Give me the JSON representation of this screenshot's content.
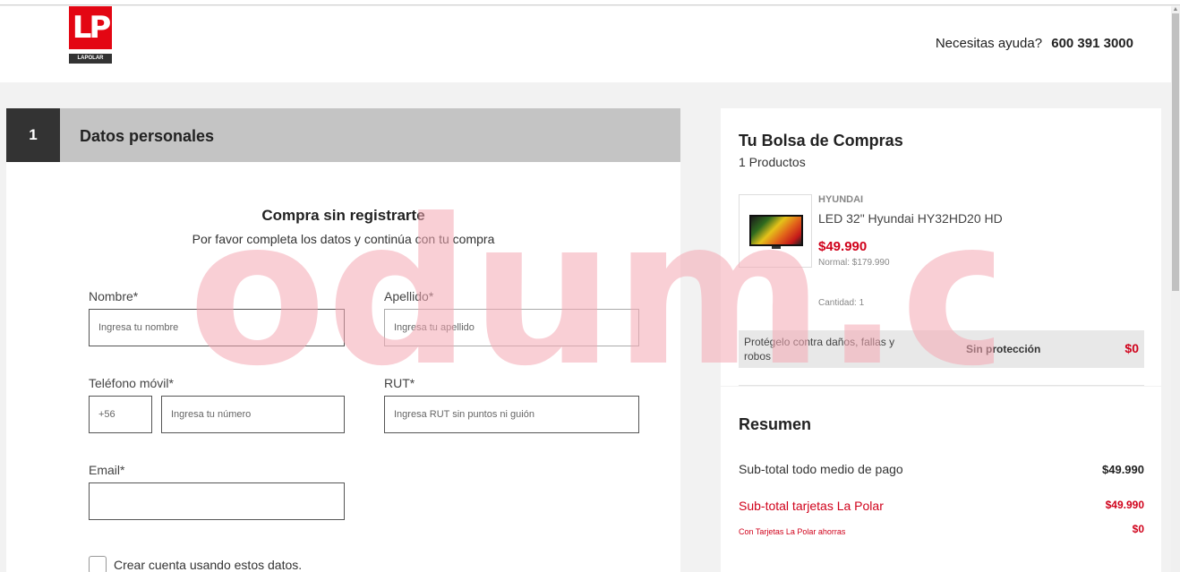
{
  "header": {
    "logo_text": "LP",
    "logo_brand": "LAPOLAR",
    "help_text": "Necesitas ayuda?",
    "help_phone": "600 391 3000"
  },
  "step": {
    "number": "1",
    "title": "Datos personales"
  },
  "guest": {
    "title": "Compra sin registrarte",
    "subtitle": "Por favor completa los datos y continúa con tu compra"
  },
  "form": {
    "nombre_label": "Nombre*",
    "nombre_placeholder": "Ingresa tu nombre",
    "apellido_label": "Apellido*",
    "apellido_placeholder": "Ingresa tu apellido",
    "telefono_label": "Teléfono móvil*",
    "telefono_prefix": "+56",
    "telefono_placeholder": "Ingresa tu número",
    "rut_label": "RUT*",
    "rut_placeholder": "Ingresa RUT sin puntos ni guión",
    "email_label": "Email*",
    "email_value": "",
    "create_account_label": "Crear cuenta usando estos datos."
  },
  "bag": {
    "title": "Tu Bolsa de Compras",
    "count": "1 Productos",
    "product": {
      "brand": "HYUNDAI",
      "name": "LED 32\" Hyundai HY32HD20 HD",
      "price": "$49.990",
      "normal_label": "Normal:",
      "normal_price": "$179.990",
      "qty": "Cantidad: 1"
    },
    "protection": {
      "text": "Protégelo contra daños, fallas y robos",
      "option": "Sin protección",
      "price": "$0"
    }
  },
  "summary": {
    "title": "Resumen",
    "subtotal_label": "Sub-total todo medio de pago",
    "subtotal_value": "$49.990",
    "card_subtotal_label": "Sub-total tarjetas La Polar",
    "card_subtotal_value": "$49.990",
    "savings_label": "Con Tarjetas La Polar ahorras",
    "savings_value": "$0"
  },
  "watermark": {
    "text": "odum.cl"
  },
  "colors": {
    "brand_red": "#e30613",
    "price_red": "#d0021b",
    "watermark_pink": "#f4a7b3"
  }
}
